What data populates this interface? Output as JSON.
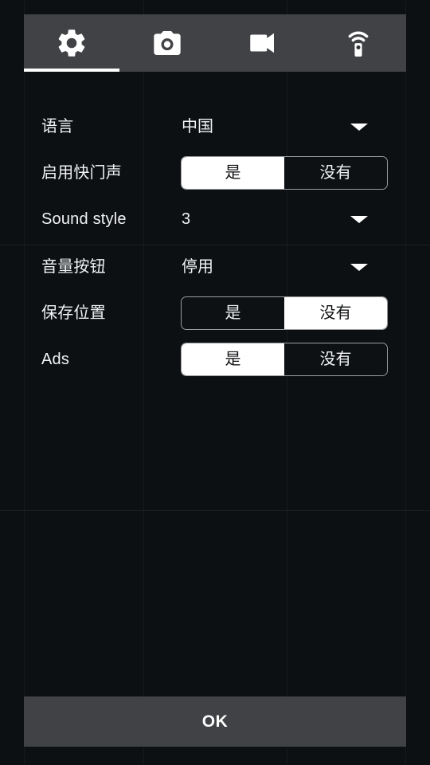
{
  "tabs": [
    {
      "id": "settings",
      "icon": "gear-icon",
      "active": true
    },
    {
      "id": "photo",
      "icon": "camera-icon",
      "active": false
    },
    {
      "id": "video",
      "icon": "video-camera-icon",
      "active": false
    },
    {
      "id": "remote",
      "icon": "wifi-remote-icon",
      "active": false
    }
  ],
  "settings": {
    "language": {
      "label": "语言",
      "value": "中国",
      "control": "dropdown"
    },
    "shutter_sound": {
      "label": "启用快门声",
      "control": "segmented",
      "options": [
        "是",
        "没有"
      ],
      "selected": "是"
    },
    "sound_style": {
      "label": "Sound style",
      "value": "3",
      "control": "dropdown"
    },
    "volume_button": {
      "label": "音量按钮",
      "value": "停用",
      "control": "dropdown"
    },
    "save_location": {
      "label": "保存位置",
      "control": "segmented",
      "options": [
        "是",
        "没有"
      ],
      "selected": "没有"
    },
    "ads": {
      "label": "Ads",
      "control": "segmented",
      "options": [
        "是",
        "没有"
      ],
      "selected": "是"
    }
  },
  "footer": {
    "ok_label": "OK"
  },
  "colors": {
    "background": "#0d1013",
    "panel": "#414245",
    "accent": "#ffffff",
    "text": "#f2f3f4",
    "border": "#9a9c9e"
  }
}
